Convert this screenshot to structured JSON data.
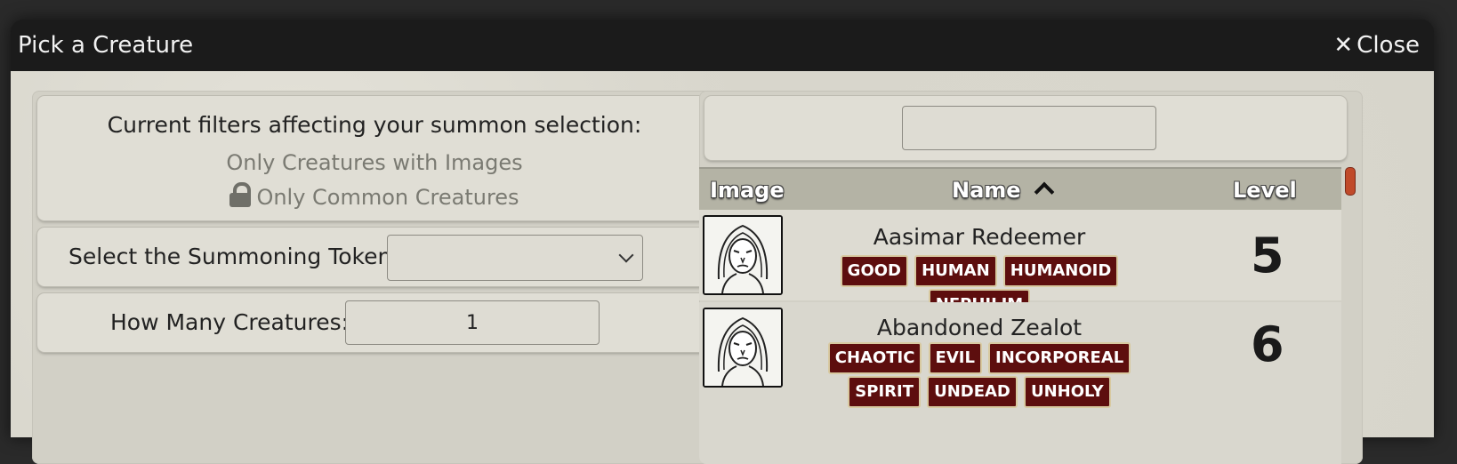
{
  "dialog": {
    "title": "Pick a Creature",
    "close_label": "Close",
    "close_glyph": "✕"
  },
  "filters": {
    "heading": "Current filters affecting your summon selection:",
    "items": [
      "Only Creatures with Images",
      "Only Common Creatures"
    ]
  },
  "token": {
    "label": "Select the Summoning Token:",
    "value": ""
  },
  "count": {
    "label": "How Many Creatures:",
    "value": "1"
  },
  "search": {
    "value": "",
    "placeholder": ""
  },
  "table": {
    "headers": {
      "image": "Image",
      "name": "Name",
      "level": "Level"
    },
    "sort": {
      "column": "Name",
      "direction": "ascending"
    },
    "rows": [
      {
        "name": "Aasimar Redeemer",
        "traits": [
          "GOOD",
          "HUMAN",
          "HUMANOID",
          "NEPHILIM"
        ],
        "level": "5"
      },
      {
        "name": "Abandoned Zealot",
        "traits": [
          "CHAOTIC",
          "EVIL",
          "INCORPOREAL",
          "SPIRIT",
          "UNDEAD",
          "UNHOLY"
        ],
        "level": "6"
      }
    ]
  },
  "colors": {
    "titlebar": "#1b1b1b",
    "background": "#d7d5cb",
    "trait_tag": "#5d0e0e",
    "table_header": "#b4b3a5",
    "scroll_thumb": "#c04a2a"
  }
}
